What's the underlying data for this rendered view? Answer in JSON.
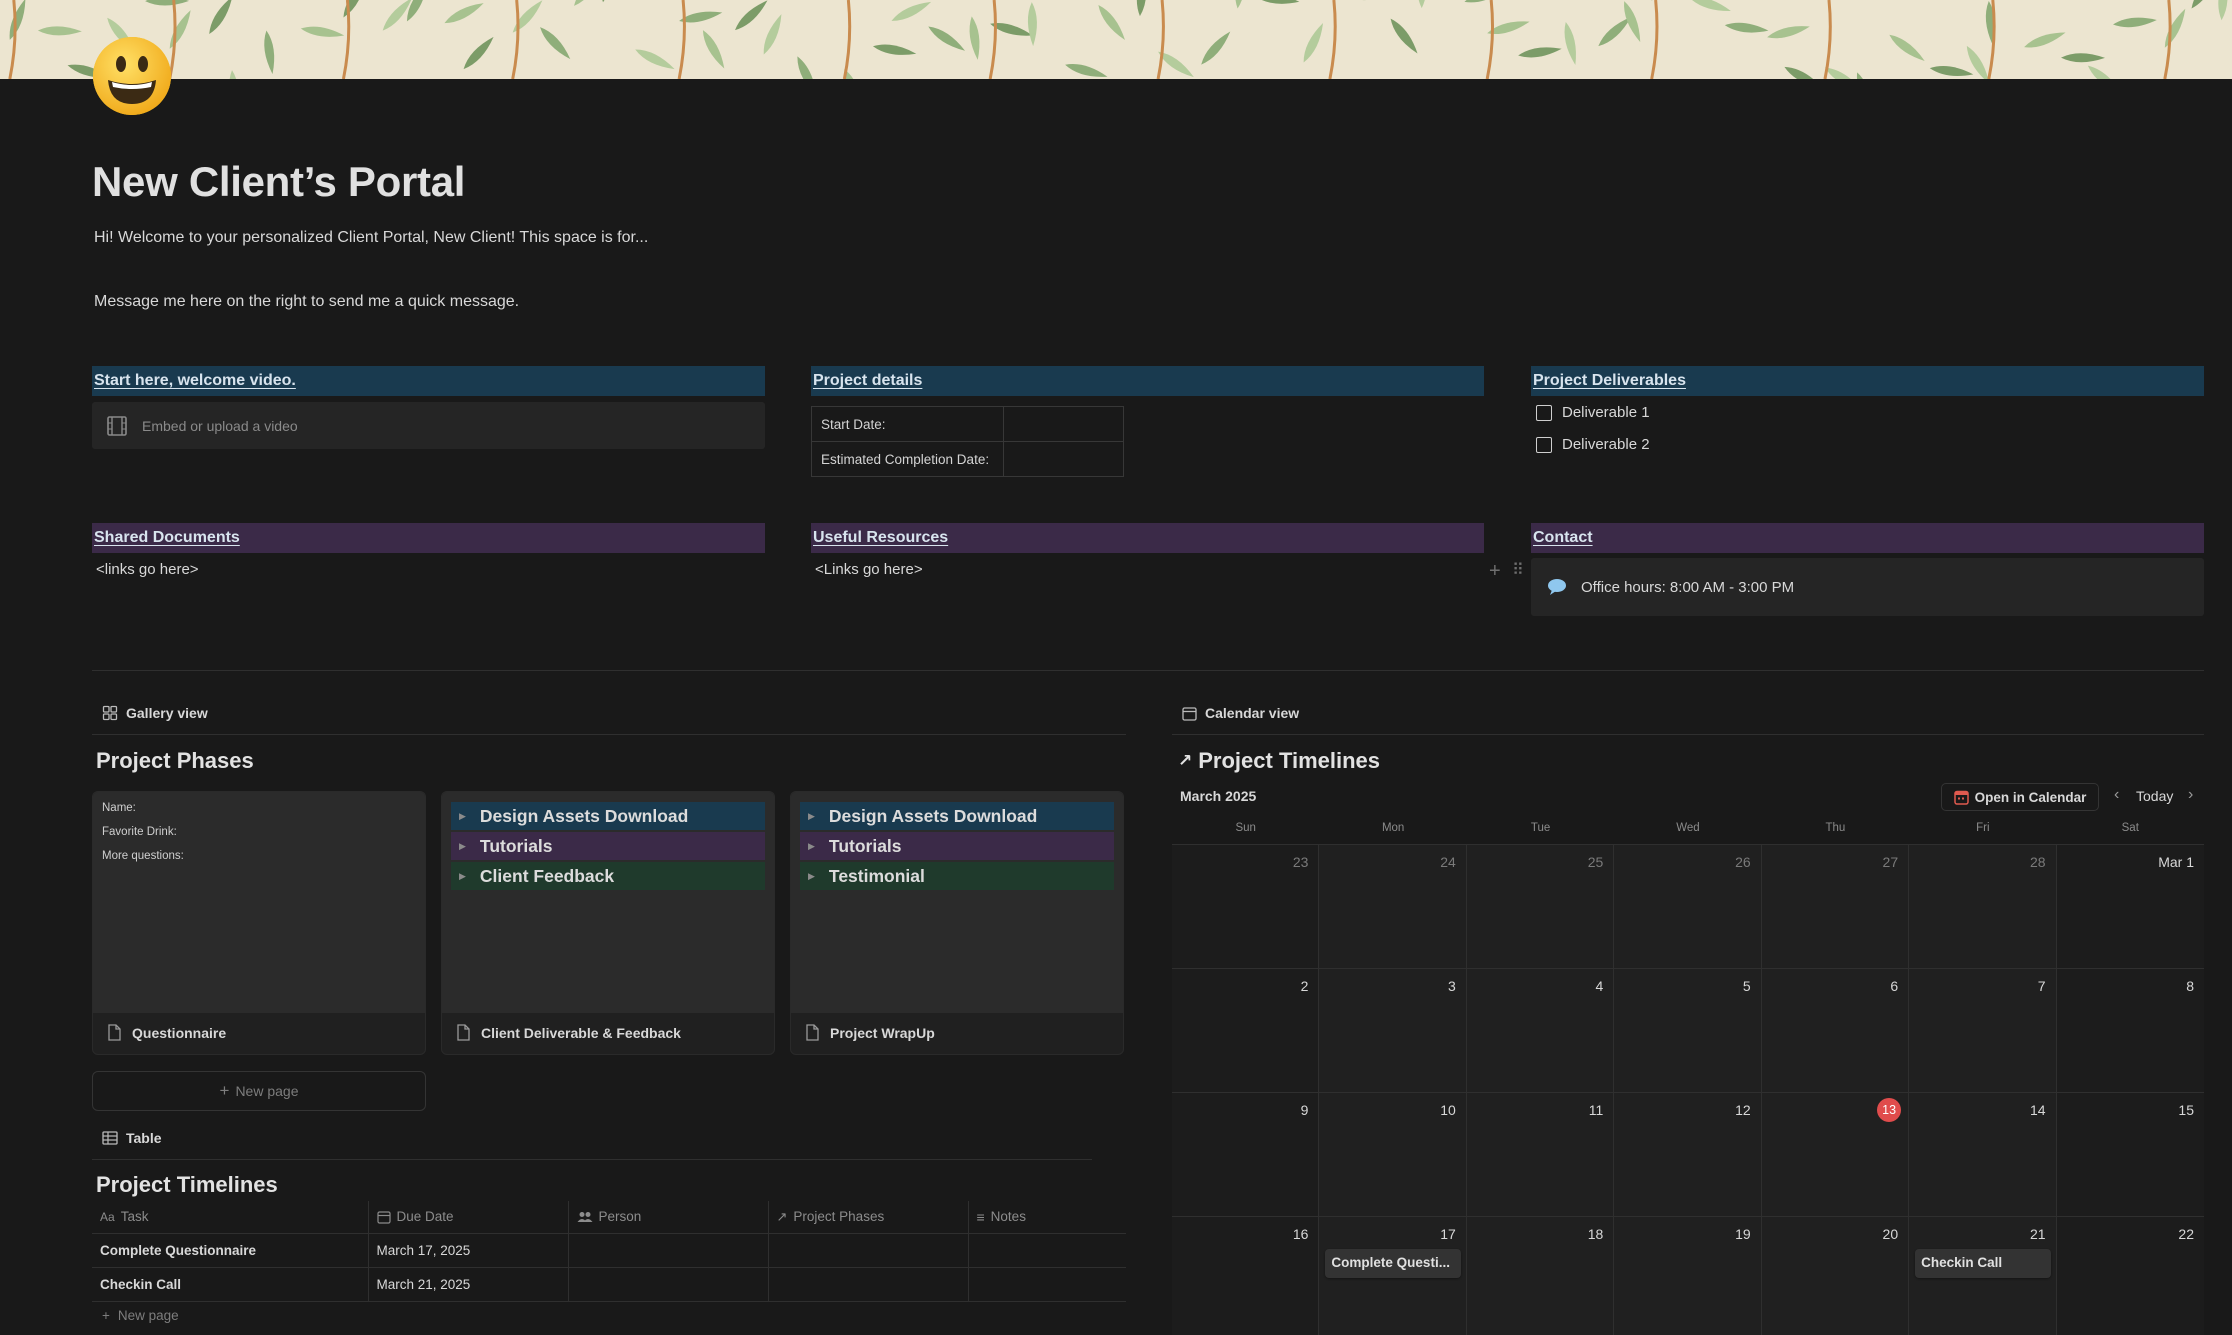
{
  "page": {
    "title": "New Client’s Portal",
    "intro": "Hi!  Welcome to your personalized Client Portal, New Client!  This space is for...",
    "message": "Message me here on the right to send me a quick message.",
    "page_icon": "smiley-emoji-icon"
  },
  "columns": {
    "welcome": {
      "heading": "Start here, welcome video.",
      "embed_placeholder": "Embed or upload a video"
    },
    "project_details": {
      "heading": "Project details",
      "rows": [
        {
          "label": "Start Date:",
          "value": ""
        },
        {
          "label": "Estimated Completion Date:",
          "value": ""
        }
      ]
    },
    "deliverables": {
      "heading": "Project Deliverables",
      "items": [
        {
          "label": "Deliverable 1",
          "checked": false
        },
        {
          "label": "Deliverable 2",
          "checked": false
        }
      ]
    },
    "shared_documents": {
      "heading": "Shared Documents",
      "text": "<links go here>"
    },
    "useful_resources": {
      "heading": "Useful Resources",
      "text": "<Links go here>"
    },
    "contact": {
      "heading": "Contact",
      "callout": "Office hours: 8:00 AM - 3:00 PM"
    }
  },
  "gallery": {
    "view_label": "Gallery view",
    "title": "Project Phases",
    "cards": [
      {
        "name": "Questionnaire",
        "preview_lines": [
          "Name:",
          "Favorite Drink:",
          "More questions:"
        ]
      },
      {
        "name": "Client Deliverable & Feedback",
        "toggles": [
          {
            "label": "Design Assets Download",
            "color": "#193a4f"
          },
          {
            "label": "Tutorials",
            "color": "#3b2a48"
          },
          {
            "label": "Client Feedback",
            "color": "#1f3a2c"
          }
        ]
      },
      {
        "name": "Project WrapUp",
        "toggles": [
          {
            "label": "Design Assets Download",
            "color": "#193a4f"
          },
          {
            "label": "Tutorials",
            "color": "#3b2a48"
          },
          {
            "label": "Testimonial",
            "color": "#1f3a2c"
          }
        ]
      }
    ],
    "new_page": "New page"
  },
  "table": {
    "view_label": "Table",
    "title": "Project Timelines",
    "columns": [
      {
        "label": "Task",
        "icon": "text-aa-icon"
      },
      {
        "label": "Due Date",
        "icon": "calendar-icon"
      },
      {
        "label": "Person",
        "icon": "people-icon"
      },
      {
        "label": "Project Phases",
        "icon": "relation-arrow-icon"
      },
      {
        "label": "Notes",
        "icon": "lines-icon"
      }
    ],
    "rows": [
      {
        "task": "Complete Questionnaire",
        "due": "March 17, 2025",
        "person": "",
        "phase": "",
        "notes": ""
      },
      {
        "task": "Checkin Call",
        "due": "March 21, 2025",
        "person": "",
        "phase": "",
        "notes": ""
      }
    ],
    "new_page": "New page"
  },
  "calendar": {
    "view_label": "Calendar view",
    "title": "Project Timelines",
    "month": "March 2025",
    "open_button": "Open in Calendar",
    "today_button": "Today",
    "weekdays": [
      "Sun",
      "Mon",
      "Tue",
      "Wed",
      "Thu",
      "Fri",
      "Sat"
    ],
    "weeks": [
      [
        "23",
        "24",
        "25",
        "26",
        "27",
        "28",
        "Mar 1"
      ],
      [
        "2",
        "3",
        "4",
        "5",
        "6",
        "7",
        "8"
      ],
      [
        "9",
        "10",
        "11",
        "12",
        "13",
        "14",
        "15"
      ],
      [
        "16",
        "17",
        "18",
        "19",
        "20",
        "21",
        "22"
      ]
    ],
    "today": "13",
    "today_color": "#e04c4c",
    "events": [
      {
        "day": "17",
        "label": "Complete Questi..."
      },
      {
        "day": "21",
        "label": "Checkin Call"
      }
    ]
  }
}
